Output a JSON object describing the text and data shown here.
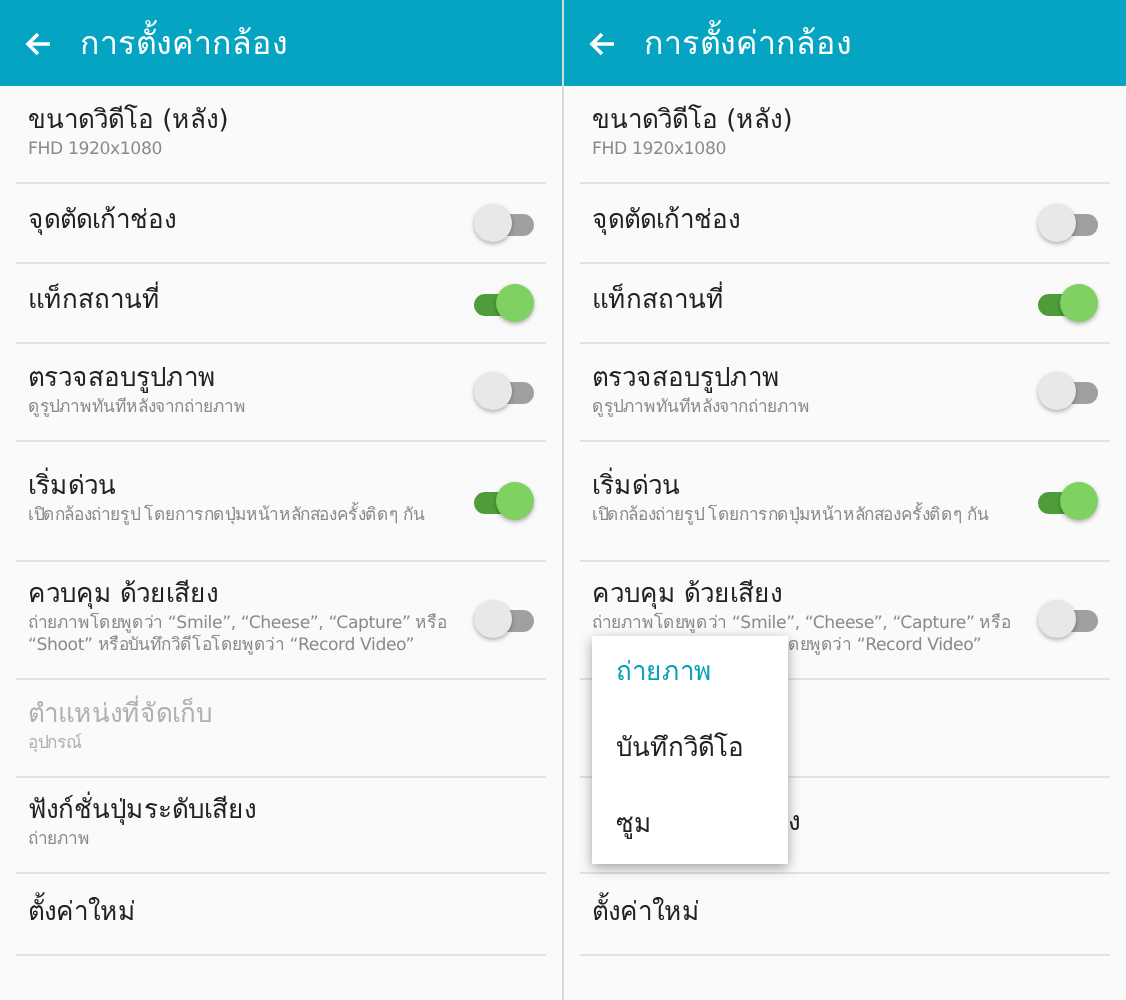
{
  "screens": [
    {
      "header": {
        "title": "การตั้งค่ากล้อง"
      },
      "settings": [
        {
          "kind": "plain",
          "title": "ขนาดวิดีโอ (หลัง)",
          "subtitle": "FHD 1920x1080"
        },
        {
          "kind": "toggle",
          "title": "จุดตัดเก้าช่อง",
          "on": false
        },
        {
          "kind": "toggle",
          "title": "แท็กสถานที่",
          "on": true
        },
        {
          "kind": "toggle",
          "title": "ตรวจสอบรูปภาพ",
          "subtitle": "ดูรูปภาพทันทีหลังจากถ่ายภาพ",
          "on": false
        },
        {
          "kind": "toggle",
          "title": "เริ่มด่วน",
          "subtitle": "เปิดกล้องถ่ายรูป โดยการกดปุ่มหน้าหลักสองครั้งติดๆ กัน",
          "on": true
        },
        {
          "kind": "toggle",
          "title": "ควบคุม ด้วยเสียง",
          "subtitle": "ถ่ายภาพโดยพูดว่า “Smile”, “Cheese”, “Capture” หรือ “Shoot” หรือบันทึกวิดีโอโดยพูดว่า “Record Video”",
          "on": false
        },
        {
          "kind": "plain",
          "title": "ตำแหน่งที่จัดเก็บ",
          "subtitle": "อุปกรณ์",
          "disabled": true
        },
        {
          "kind": "plain",
          "title": "ฟังก์ชั่นปุ่มระดับเสียง",
          "subtitle": "ถ่ายภาพ"
        },
        {
          "kind": "plain",
          "title": "ตั้งค่าใหม่"
        }
      ]
    },
    {
      "header": {
        "title": "การตั้งค่ากล้อง"
      },
      "settings": [
        {
          "kind": "plain",
          "title": "ขนาดวิดีโอ (หลัง)",
          "subtitle": "FHD 1920x1080"
        },
        {
          "kind": "toggle",
          "title": "จุดตัดเก้าช่อง",
          "on": false
        },
        {
          "kind": "toggle",
          "title": "แท็กสถานที่",
          "on": true
        },
        {
          "kind": "toggle",
          "title": "ตรวจสอบรูปภาพ",
          "subtitle": "ดูรูปภาพทันทีหลังจากถ่ายภาพ",
          "on": false
        },
        {
          "kind": "toggle",
          "title": "เริ่มด่วน",
          "subtitle": "เปิดกล้องถ่ายรูป โดยการกดปุ่มหน้าหลักสองครั้งติดๆ กัน",
          "on": true
        },
        {
          "kind": "toggle",
          "title": "ควบคุม ด้วยเสียง",
          "subtitle": "ถ่ายภาพโดยพูดว่า “Smile”, “Cheese”, “Capture” หรือ",
          "subtitle_tail": "ดยพูดว่า “Record Video”",
          "on": false
        },
        {
          "kind": "blank"
        },
        {
          "kind": "plain",
          "title_tail": "ง"
        },
        {
          "kind": "plain",
          "title": "ตั้งค่าใหม่"
        }
      ],
      "popup": {
        "options": [
          {
            "label": "ถ่ายภาพ",
            "selected": true
          },
          {
            "label": "บันทึกวิดีโอ",
            "selected": false
          },
          {
            "label": "ซูม",
            "selected": false
          }
        ]
      }
    }
  ]
}
